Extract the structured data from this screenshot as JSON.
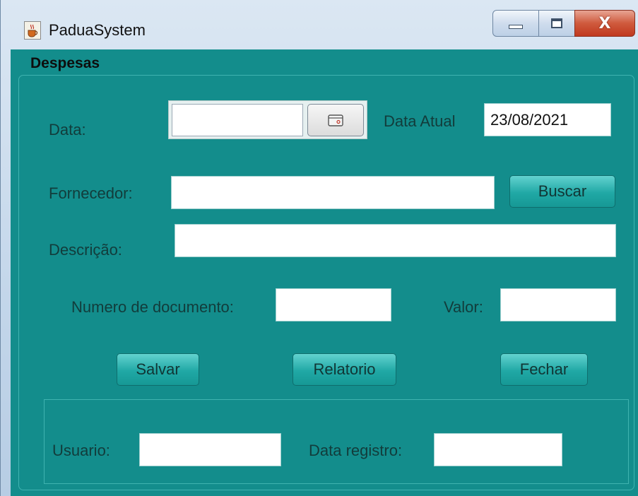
{
  "window": {
    "title": "PaduaSystem",
    "icon": "java-cup-icon",
    "controls": [
      "minimize-icon",
      "maximize-icon",
      "close-icon"
    ],
    "close_glyph": "X"
  },
  "section": {
    "title": "Despesas"
  },
  "form": {
    "data_label": "Data:",
    "data_value": "",
    "calendar_icon": "calendar-icon",
    "data_atual_label": "Data Atual",
    "data_atual_value": "23/08/2021",
    "fornecedor_label": "Fornecedor:",
    "fornecedor_value": "",
    "buscar_label": "Buscar",
    "descricao_label": "Descrição:",
    "descricao_value": "",
    "numero_documento_label": "Numero de documento:",
    "numero_documento_value": "",
    "valor_label": "Valor:",
    "valor_value": ""
  },
  "actions": {
    "salvar_label": "Salvar",
    "relatorio_label": "Relatorio",
    "fechar_label": "Fechar"
  },
  "footer": {
    "usuario_label": "Usuario:",
    "usuario_value": "",
    "data_registro_label": "Data registro:",
    "data_registro_value": ""
  },
  "colors": {
    "panel_bg": "#138d8c",
    "button_bg": "#20a8a5",
    "title_bar": "#c3d6ea",
    "close_button": "#cf5a3d"
  }
}
